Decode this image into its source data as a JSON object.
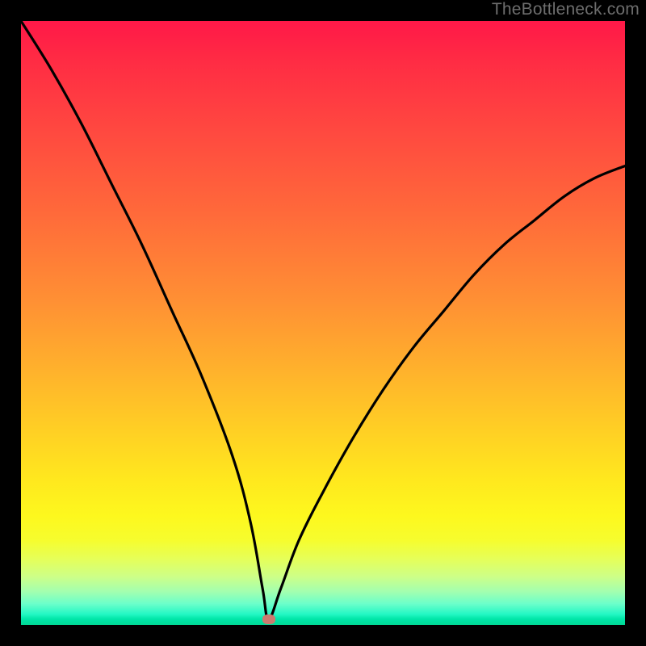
{
  "watermark": "TheBottleneck.com",
  "colors": {
    "frame": "#000000",
    "top": "#ff1848",
    "mid": "#ffd024",
    "bottom": "#00d895",
    "curve": "#000000",
    "marker": "#cc7b6f",
    "watermark_text": "#6d6d6d"
  },
  "chart_data": {
    "type": "line",
    "title": "",
    "xlabel": "",
    "ylabel": "",
    "xlim": [
      0,
      100
    ],
    "ylim": [
      0,
      100
    ],
    "grid": false,
    "legend": false,
    "annotations": [],
    "marker": {
      "x": 41,
      "y": 1,
      "shape": "ellipse",
      "color": "#cc7b6f"
    },
    "series": [
      {
        "name": "bottleneck-curve",
        "x": [
          0,
          5,
          10,
          15,
          20,
          25,
          30,
          35,
          38,
          40,
          41,
          43,
          46,
          50,
          55,
          60,
          65,
          70,
          75,
          80,
          85,
          90,
          95,
          100
        ],
        "values": [
          100,
          92,
          83,
          73,
          63,
          52,
          41,
          28,
          17,
          6,
          1,
          6,
          14,
          22,
          31,
          39,
          46,
          52,
          58,
          63,
          67,
          71,
          74,
          76
        ]
      }
    ],
    "background_gradient": {
      "direction": "vertical",
      "stops": [
        {
          "pos": 0.0,
          "color": "#ff1848"
        },
        {
          "pos": 0.46,
          "color": "#ff8f34"
        },
        {
          "pos": 0.76,
          "color": "#ffe81e"
        },
        {
          "pos": 0.96,
          "color": "#6bffca"
        },
        {
          "pos": 1.0,
          "color": "#00d895"
        }
      ]
    }
  }
}
